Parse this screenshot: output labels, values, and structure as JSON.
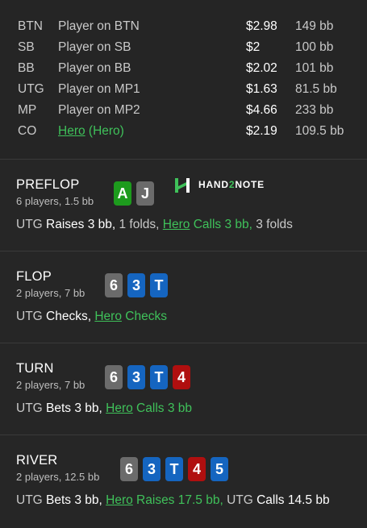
{
  "players": [
    {
      "pos": "BTN",
      "name": "Player on BTN",
      "stack": "$2.98",
      "bb": "149 bb"
    },
    {
      "pos": "SB",
      "name": "Player on SB",
      "stack": "$2",
      "bb": "100 bb"
    },
    {
      "pos": "BB",
      "name": "Player on BB",
      "stack": "$2.02",
      "bb": "101 bb"
    },
    {
      "pos": "UTG",
      "name": "Player on MP1",
      "stack": "$1.63",
      "bb": "81.5 bb"
    },
    {
      "pos": "MP",
      "name": "Player on MP2",
      "stack": "$4.66",
      "bb": "233 bb"
    },
    {
      "pos": "CO",
      "name": "Hero",
      "name_suffix": " (Hero)",
      "stack": "$2.19",
      "bb": "109.5 bb"
    }
  ],
  "logo": {
    "prefix": "HAND",
    "two": "2",
    "suffix": "NOTE"
  },
  "preflop": {
    "title": "PREFLOP",
    "sub": "6 players, 1.5 bb",
    "cards": [
      {
        "rank": "A",
        "color": "green"
      },
      {
        "rank": "J",
        "color": "gray"
      }
    ],
    "action": {
      "a1": "UTG ",
      "a2": "Raises 3 bb,",
      "a3": " 1 folds, ",
      "a4": "Hero",
      "a5": " Calls 3 bb,",
      "a6": " 3 folds"
    }
  },
  "flop": {
    "title": "FLOP",
    "sub": "2 players, 7 bb",
    "cards": [
      {
        "rank": "6",
        "color": "gray"
      },
      {
        "rank": "3",
        "color": "blue"
      },
      {
        "rank": "T",
        "color": "blue"
      }
    ],
    "action": {
      "a1": "UTG ",
      "a2": "Checks,",
      "a3": " ",
      "a4": "Hero",
      "a5": " Checks"
    }
  },
  "turn": {
    "title": "TURN",
    "sub": "2 players, 7 bb",
    "cards": [
      {
        "rank": "6",
        "color": "gray"
      },
      {
        "rank": "3",
        "color": "blue"
      },
      {
        "rank": "T",
        "color": "blue"
      },
      {
        "rank": "4",
        "color": "red"
      }
    ],
    "action": {
      "a1": "UTG ",
      "a2": "Bets 3 bb,",
      "a3": " ",
      "a4": "Hero",
      "a5": " Calls 3 bb"
    }
  },
  "river": {
    "title": "RIVER",
    "sub": "2 players, 12.5 bb",
    "cards": [
      {
        "rank": "6",
        "color": "gray"
      },
      {
        "rank": "3",
        "color": "blue"
      },
      {
        "rank": "T",
        "color": "blue"
      },
      {
        "rank": "4",
        "color": "red"
      },
      {
        "rank": "5",
        "color": "blue"
      }
    ],
    "action": {
      "a1": "UTG ",
      "a2": "Bets 3 bb,",
      "a3": " ",
      "a4": "Hero",
      "a5": " Raises 17.5 bb,",
      "a6": " UTG ",
      "a7": "Calls 14.5 bb"
    }
  },
  "colors": {
    "hero": "#3fc15a",
    "card_gray": "#6b6b6b",
    "card_blue": "#1565c0",
    "card_red": "#b00f0f",
    "card_green": "#1d9b1d"
  }
}
